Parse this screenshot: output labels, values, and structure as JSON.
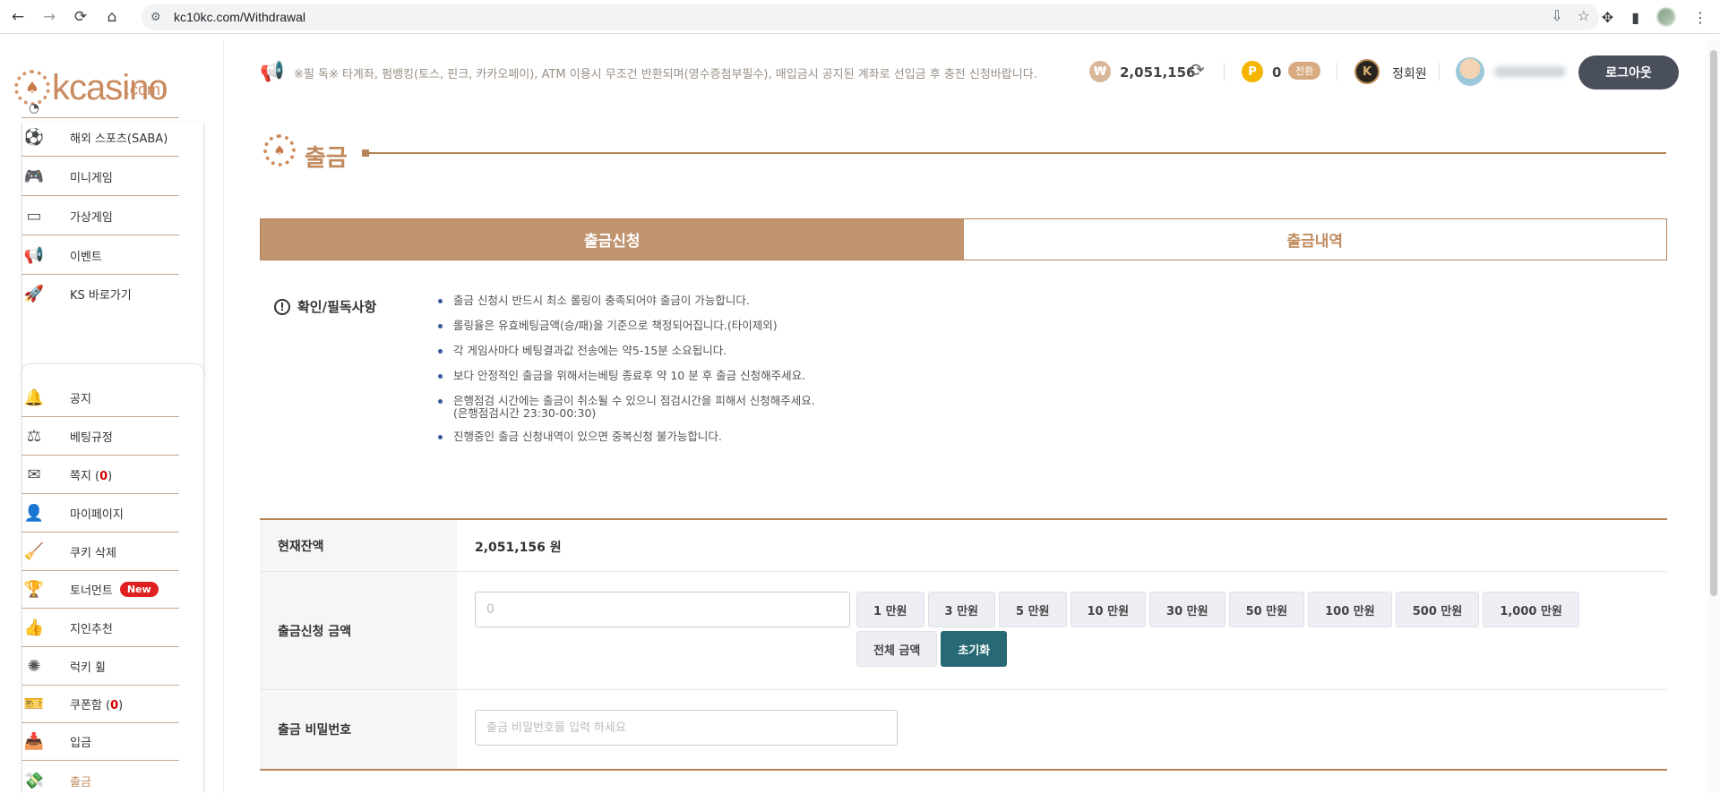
{
  "browser": {
    "url": "kc10kc.com/Withdrawal"
  },
  "logo": {
    "text": "kcasino",
    "sub": ".com"
  },
  "sidebar": {
    "top_items": [
      {
        "label": "해외 스포츠(SABA)",
        "icon": "soccer-ball-icon"
      },
      {
        "label": "미니게임",
        "icon": "gamepad-icon"
      },
      {
        "label": "가상게임",
        "icon": "vr-headset-icon"
      },
      {
        "label": "이벤트",
        "icon": "megaphone-icon"
      },
      {
        "label": "KS 바로가기",
        "icon": "rocket-icon"
      }
    ],
    "bottom_items": [
      {
        "label": "공지",
        "icon": "bell-icon"
      },
      {
        "label": "베팅규정",
        "icon": "scales-icon"
      },
      {
        "label": "쪽지 (",
        "count": "0",
        "tail": ")",
        "icon": "envelope-icon"
      },
      {
        "label": "마이페이지",
        "icon": "user-icon"
      },
      {
        "label": "쿠키 삭제",
        "icon": "broom-icon"
      },
      {
        "label": "토너먼트",
        "badge": "New",
        "icon": "trophy-icon"
      },
      {
        "label": "지인추천",
        "icon": "thumbs-up-icon"
      },
      {
        "label": "럭키 휠",
        "icon": "wheel-icon"
      },
      {
        "label": "쿠폰함 (",
        "count": "0",
        "tail": ")",
        "icon": "coupon-icon"
      },
      {
        "label": "입금",
        "icon": "deposit-icon"
      },
      {
        "label": "출금",
        "icon": "withdraw-icon"
      }
    ]
  },
  "header": {
    "notice": "※필 독※ 타계좌, 펌뱅킹(토스, 핀크, 카카오페이), ATM 이용시 무조건 반환되며(영수증첨부필수), 매입금시 공지된 계좌로 선입금 후 충전 신청바랍니다.",
    "won_symbol": "₩",
    "balance": "2,051,156",
    "point_symbol": "P",
    "points": "0",
    "convert_label": "전환",
    "level_letter": "K",
    "level_label": "정회원",
    "logout_label": "로그아웃"
  },
  "page": {
    "title": "출금",
    "tabs": [
      {
        "label": "출금신청",
        "active": true
      },
      {
        "label": "출금내역",
        "active": false
      }
    ],
    "notice_title": "확인/필독사항",
    "rules": [
      "출금 신청시 반드시 최소 롤링이 충족되어야 출금이 가능합니다.",
      "롤링율은 유효베팅금액(승/패)을 기준으로 책정되어집니다.(타이제외)",
      "각 게임사마다 베팅결과값 전송에는 약5-15분 소요됩니다.",
      "보다 안정적인 출금을 위해서는베팅 종료후 약 10 분 후 출금 신청해주세요.",
      "은행점검 시간에는 출금이 취소될 수 있으니 점검시간을 피해서 신청해주세요.",
      "(은행점검시간 23:30-00:30)",
      "진행중인 출금 신청내역이 있으면 중복신청 불가능합니다."
    ]
  },
  "form": {
    "balance_label": "현재잔액",
    "balance_value": "2,051,156 원",
    "amount_label": "출금신청 금액",
    "amount_placeholder": "0",
    "amount_buttons": [
      "1 만원",
      "3 만원",
      "5 만원",
      "10 만원",
      "30 만원",
      "50 만원",
      "100 만원",
      "500 만원",
      "1,000 만원"
    ],
    "full_amount_label": "전체 금액",
    "reset_label": "초기화",
    "password_label": "출금 비밀번호",
    "password_placeholder": "출금 비밀번호를 입력 하세요"
  },
  "colors": {
    "accent": "#c19470",
    "reset": "#276a76",
    "logout": "#4a4f5c"
  }
}
